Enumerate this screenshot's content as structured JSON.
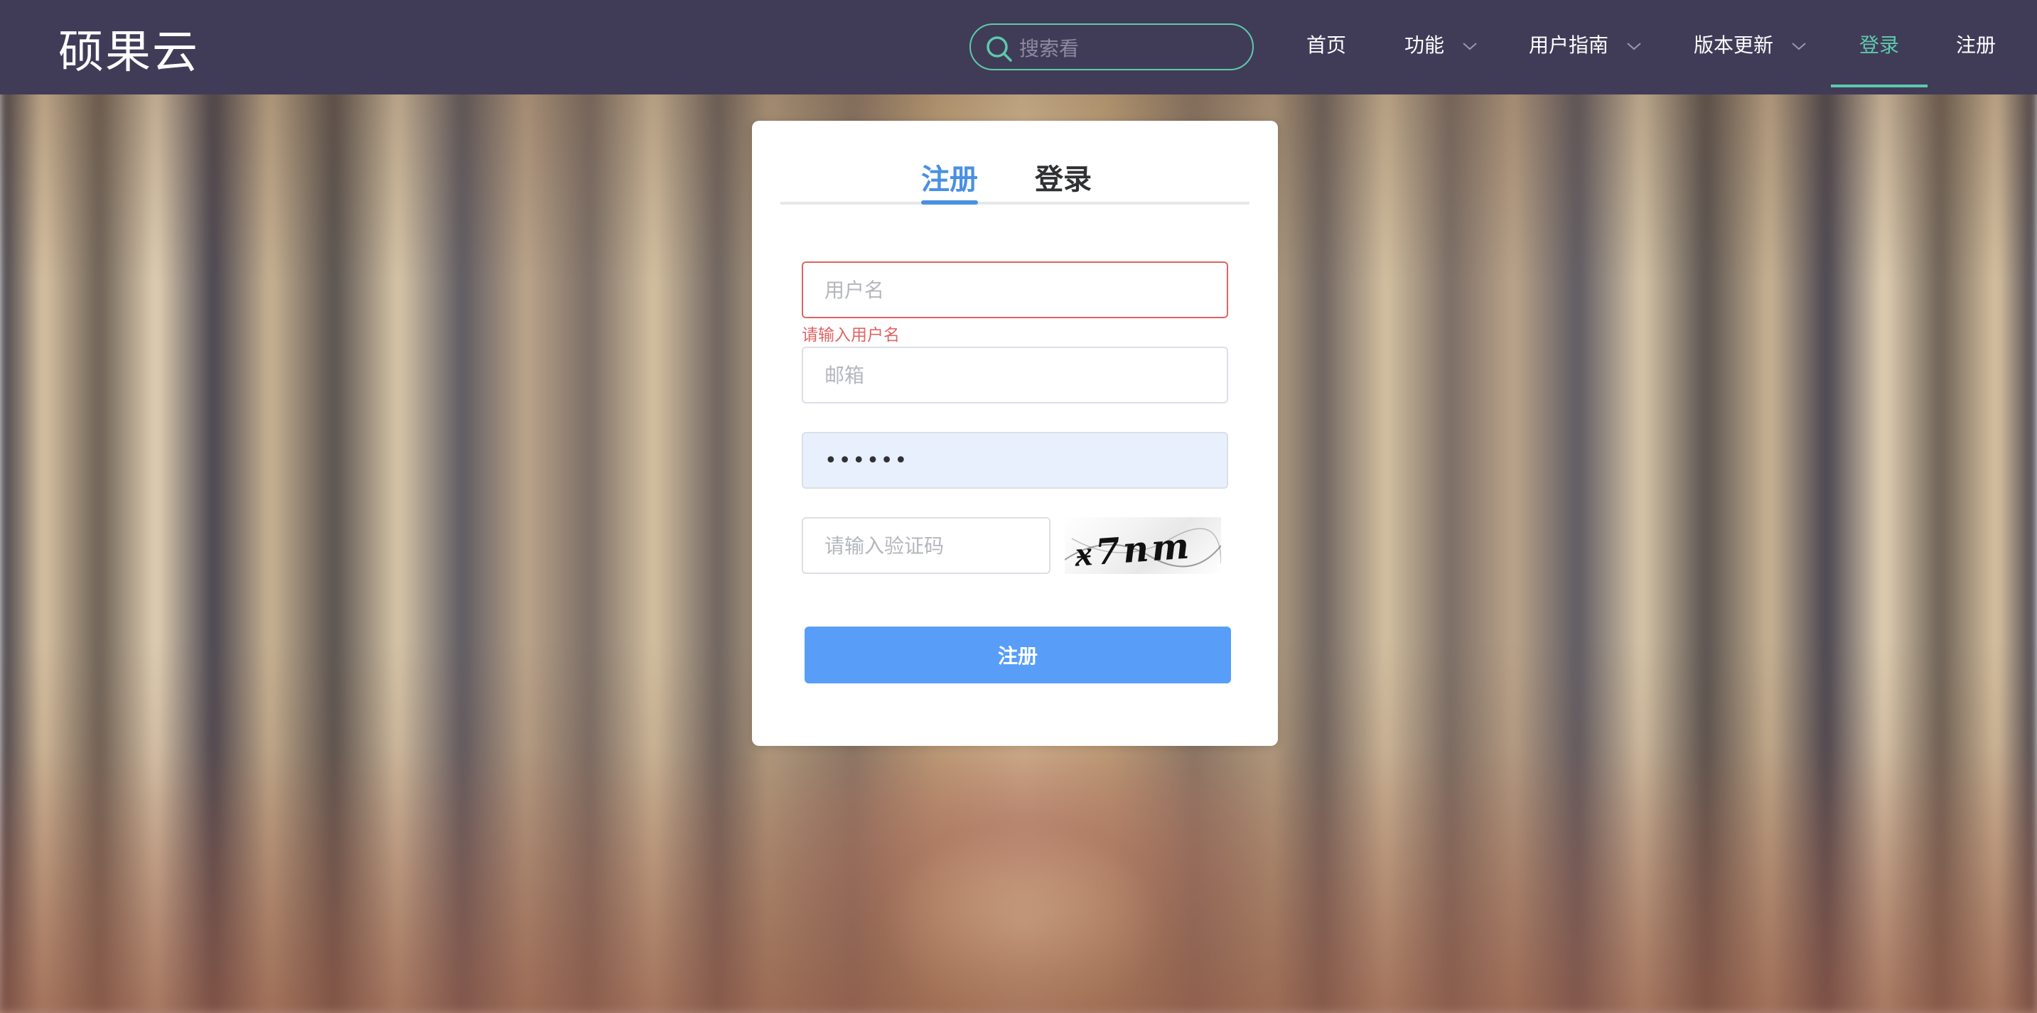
{
  "brand": {
    "logo": "硕果云"
  },
  "search": {
    "placeholder": "搜索看",
    "icon": "search-icon"
  },
  "nav": {
    "items": [
      {
        "label": "首页",
        "has_dropdown": false
      },
      {
        "label": "功能",
        "has_dropdown": true
      },
      {
        "label": "用户指南",
        "has_dropdown": true
      },
      {
        "label": "版本更新",
        "has_dropdown": true
      },
      {
        "label": "登录",
        "has_dropdown": false,
        "active": true
      },
      {
        "label": "注册",
        "has_dropdown": false
      }
    ]
  },
  "form": {
    "tabs": [
      {
        "label": "注册",
        "active": true
      },
      {
        "label": "登录",
        "active": false
      }
    ],
    "username_placeholder": "用户名",
    "username_error": "请输入用户名",
    "email_placeholder": "邮箱",
    "password_value": "••••••",
    "captcha_placeholder": "请输入验证码",
    "captcha_text": "ӿ7nm",
    "submit_label": "注册"
  },
  "colors": {
    "navbar_bg": "#403c58",
    "accent_green": "#5ec9ad",
    "tab_active": "#4a90e2",
    "button_bg": "#589ef8",
    "error": "#e06464",
    "autofill_bg": "#e8f0fe"
  }
}
